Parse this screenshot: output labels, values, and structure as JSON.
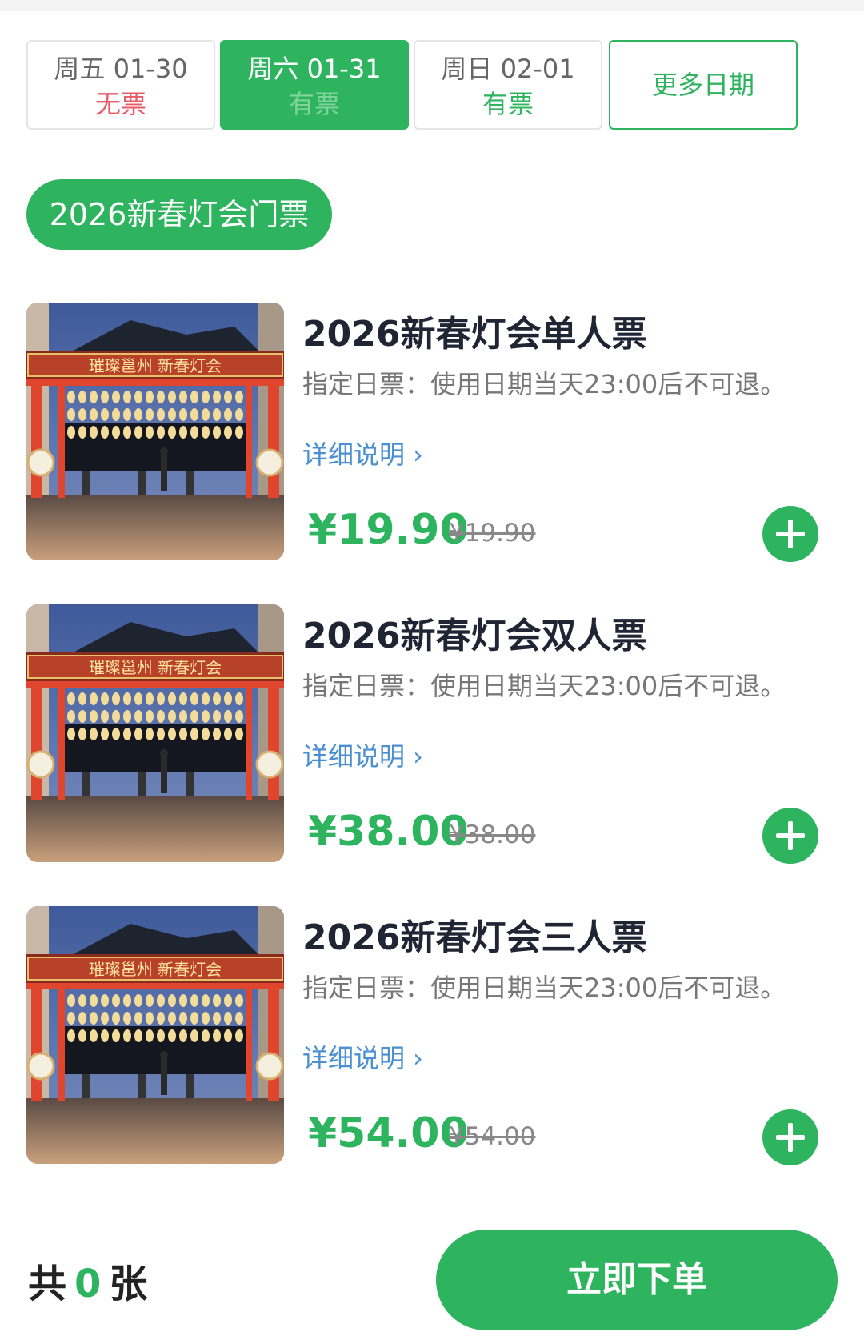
{
  "dates": [
    {
      "day": "周五 01-30",
      "stock": "无票",
      "selected": false
    },
    {
      "day": "周六 01-31",
      "stock": "有票",
      "selected": true
    },
    {
      "day": "周日 02-01",
      "stock": "有票",
      "selected": false
    }
  ],
  "more_dates_label": "更多日期",
  "category": "2026新春灯会门票",
  "thumbnail_sign": "璀璨邕州 新春灯会",
  "tickets": [
    {
      "title": "2026新春灯会单人票",
      "desc": "指定日票：使用日期当天23:00后不可退。",
      "detail": "详细说明 ›",
      "price": "¥19.90",
      "original": "¥19.90"
    },
    {
      "title": "2026新春灯会双人票",
      "desc": "指定日票：使用日期当天23:00后不可退。",
      "detail": "详细说明 ›",
      "price": "¥38.00",
      "original": "¥38.00"
    },
    {
      "title": "2026新春灯会三人票",
      "desc": "指定日票：使用日期当天23:00后不可退。",
      "detail": "详细说明 ›",
      "price": "¥54.00",
      "original": "¥54.00"
    }
  ],
  "footer": {
    "prefix": "共",
    "count": "0",
    "suffix": "张",
    "order_label": "立即下单"
  },
  "colors": {
    "accent": "#2eb45f",
    "sold_out": "#e85a67",
    "link": "#4a8fd0"
  }
}
